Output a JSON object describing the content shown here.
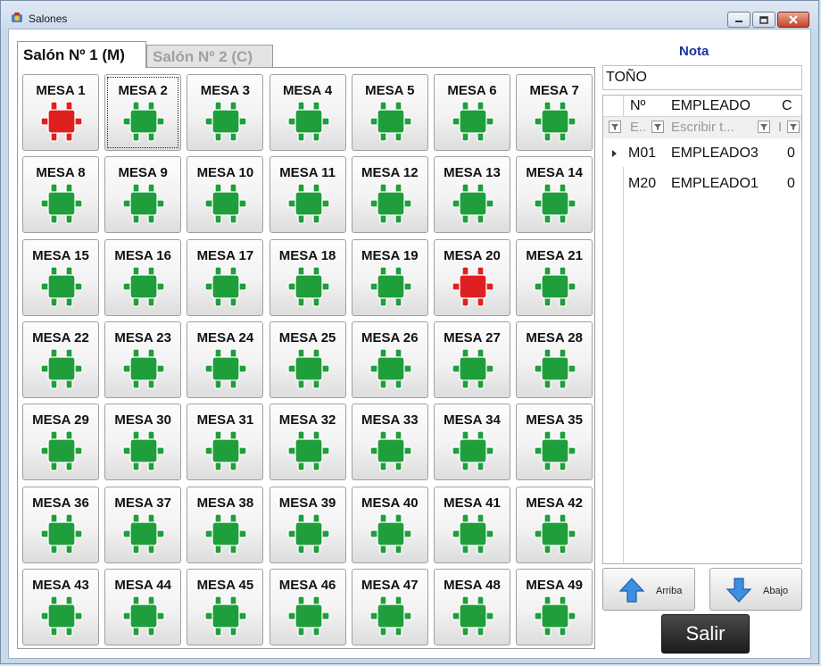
{
  "window": {
    "title": "Salones"
  },
  "tabs": [
    {
      "label": "Salón Nº 1 (M)",
      "active": true
    },
    {
      "label": "Salón Nº 2 (C)",
      "active": false
    }
  ],
  "colors": {
    "free": "#1f9e3c",
    "occupied": "#e02020",
    "accent_label": "#1a33a8"
  },
  "tables": [
    {
      "label": "MESA 1",
      "status": "occupied"
    },
    {
      "label": "MESA 2",
      "status": "free",
      "focused": true
    },
    {
      "label": "MESA 3",
      "status": "free"
    },
    {
      "label": "MESA 4",
      "status": "free"
    },
    {
      "label": "MESA 5",
      "status": "free"
    },
    {
      "label": "MESA 6",
      "status": "free"
    },
    {
      "label": "MESA 7",
      "status": "free"
    },
    {
      "label": "MESA 8",
      "status": "free"
    },
    {
      "label": "MESA 9",
      "status": "free"
    },
    {
      "label": "MESA 10",
      "status": "free"
    },
    {
      "label": "MESA 11",
      "status": "free"
    },
    {
      "label": "MESA 12",
      "status": "free"
    },
    {
      "label": "MESA 13",
      "status": "free"
    },
    {
      "label": "MESA 14",
      "status": "free"
    },
    {
      "label": "MESA 15",
      "status": "free"
    },
    {
      "label": "MESA 16",
      "status": "free"
    },
    {
      "label": "MESA 17",
      "status": "free"
    },
    {
      "label": "MESA 18",
      "status": "free"
    },
    {
      "label": "MESA 19",
      "status": "free"
    },
    {
      "label": "MESA 20",
      "status": "occupied"
    },
    {
      "label": "MESA 21",
      "status": "free"
    },
    {
      "label": "MESA 22",
      "status": "free"
    },
    {
      "label": "MESA 23",
      "status": "free"
    },
    {
      "label": "MESA 24",
      "status": "free"
    },
    {
      "label": "MESA 25",
      "status": "free"
    },
    {
      "label": "MESA 26",
      "status": "free"
    },
    {
      "label": "MESA 27",
      "status": "free"
    },
    {
      "label": "MESA 28",
      "status": "free"
    },
    {
      "label": "MESA 29",
      "status": "free"
    },
    {
      "label": "MESA 30",
      "status": "free"
    },
    {
      "label": "MESA 31",
      "status": "free"
    },
    {
      "label": "MESA 32",
      "status": "free"
    },
    {
      "label": "MESA 33",
      "status": "free"
    },
    {
      "label": "MESA 34",
      "status": "free"
    },
    {
      "label": "MESA 35",
      "status": "free"
    },
    {
      "label": "MESA 36",
      "status": "free"
    },
    {
      "label": "MESA 37",
      "status": "free"
    },
    {
      "label": "MESA 38",
      "status": "free"
    },
    {
      "label": "MESA 39",
      "status": "free"
    },
    {
      "label": "MESA 40",
      "status": "free"
    },
    {
      "label": "MESA 41",
      "status": "free"
    },
    {
      "label": "MESA 42",
      "status": "free"
    },
    {
      "label": "MESA 43",
      "status": "free"
    },
    {
      "label": "MESA 44",
      "status": "free"
    },
    {
      "label": "MESA 45",
      "status": "free"
    },
    {
      "label": "MESA 46",
      "status": "free"
    },
    {
      "label": "MESA 47",
      "status": "free"
    },
    {
      "label": "MESA 48",
      "status": "free"
    },
    {
      "label": "MESA 49",
      "status": "free"
    }
  ],
  "nota": {
    "label": "Nota",
    "value": "TOÑO"
  },
  "grid": {
    "columns": [
      "Nº",
      "EMPLEADO",
      "C"
    ],
    "filter_placeholders": [
      "E..",
      "Escribir t...",
      "I"
    ],
    "rows": [
      {
        "numero": "M01",
        "empleado": "EMPLEADO3",
        "c": "0",
        "selected": true
      },
      {
        "numero": "M20",
        "empleado": "EMPLEADO1",
        "c": "0",
        "selected": false
      }
    ]
  },
  "buttons": {
    "up": "Arriba",
    "down": "Abajo",
    "exit": "Salir"
  }
}
